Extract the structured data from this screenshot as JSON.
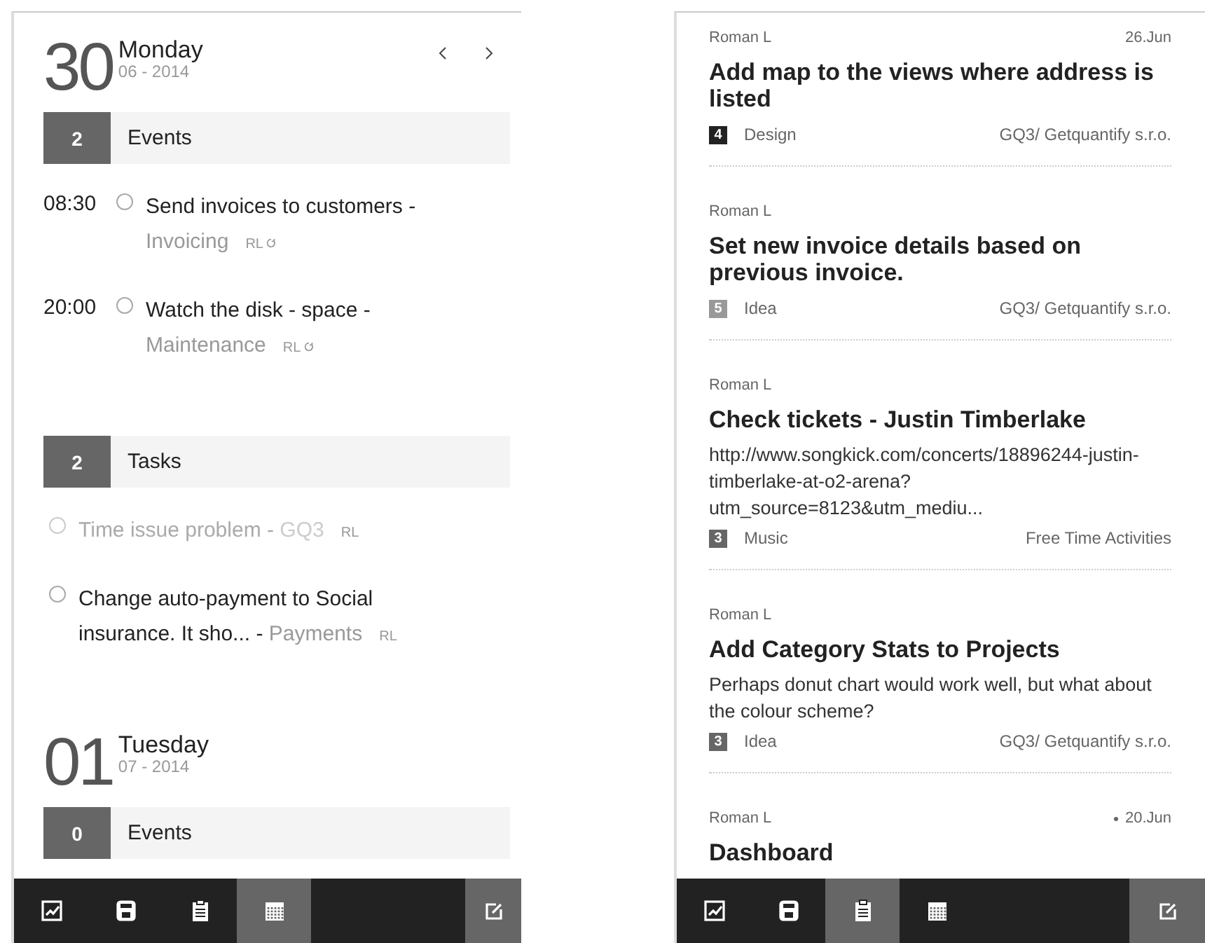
{
  "calendar_screen": {
    "days": [
      {
        "day": "30",
        "weekday": "Monday",
        "month_year": "06 - 2014",
        "show_nav": true,
        "sections": [
          {
            "count": "2",
            "label": "Events",
            "items": [
              {
                "time": "08:30",
                "title": "Send invoices to customers - ",
                "project": "Invoicing",
                "owner": "RL",
                "recurring": true,
                "completed": false
              },
              {
                "time": "20:00",
                "title": "Watch the disk - space - ",
                "project": "Maintenance",
                "owner": "RL",
                "recurring": true,
                "completed": false
              }
            ]
          },
          {
            "count": "2",
            "label": "Tasks",
            "items": [
              {
                "title": "Time issue problem - ",
                "project": "GQ3",
                "owner": "RL",
                "recurring": false,
                "completed": true
              },
              {
                "title": "Change auto-payment to Social insurance. It sho... - ",
                "project": "Payments",
                "owner": "RL",
                "recurring": false,
                "completed": false
              }
            ]
          }
        ]
      },
      {
        "day": "01",
        "weekday": "Tuesday",
        "month_year": "07 - 2014",
        "show_nav": false,
        "sections": [
          {
            "count": "0",
            "label": "Events"
          }
        ]
      }
    ],
    "nav": {
      "tabs": [
        {
          "kind": "chart",
          "selected": false
        },
        {
          "kind": "save",
          "selected": false
        },
        {
          "kind": "clipboard",
          "selected": false
        },
        {
          "kind": "calendar",
          "selected": true
        }
      ]
    }
  },
  "notes_screen": {
    "cards": [
      {
        "author": "Roman L",
        "date": "26.Jun",
        "flagged": false,
        "title": "Add map to the views where address is listed",
        "priority": "4",
        "color": "#222222",
        "category": "Design",
        "project": "GQ3/ Getquantify s.r.o."
      },
      {
        "author": "Roman L",
        "title": "Set new invoice details based on previous invoice.",
        "priority": "5",
        "color": "#999999",
        "category": "Idea",
        "project": "GQ3/ Getquantify s.r.o."
      },
      {
        "author": "Roman L",
        "title": "Check tickets - Justin Timberlake",
        "description": "http://www.songkick.com/concerts/18896244-justin-timberlake-at-o2-arena?utm_source=8123&utm_mediu...",
        "priority": "3",
        "color": "#666666",
        "category": "Music",
        "project": "Free Time Activities"
      },
      {
        "author": "Roman L",
        "title": "Add Category Stats to Projects",
        "description": "Perhaps donut chart would work well, but what about the colour scheme?",
        "priority": "3",
        "color": "#666666",
        "category": "Idea",
        "project": "GQ3/ Getquantify s.r.o."
      },
      {
        "author": "Roman L",
        "date": "20.Jun",
        "flagged": true,
        "title": "Dashboard"
      }
    ],
    "nav": {
      "tabs": [
        {
          "kind": "chart",
          "selected": false
        },
        {
          "kind": "save",
          "selected": false
        },
        {
          "kind": "clipboard",
          "selected": true
        },
        {
          "kind": "calendar",
          "selected": false
        }
      ]
    }
  }
}
